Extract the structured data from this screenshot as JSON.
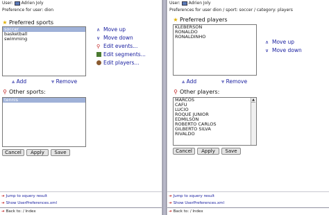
{
  "left": {
    "header": {
      "user_label": "User:",
      "user_name": "Adrien Joly"
    },
    "subtitle": "Preference for user: dion",
    "preferred": {
      "title": "Preferred sports",
      "items": [
        "soccer",
        "basketball",
        "swimming"
      ],
      "selected_index": 0
    },
    "actions": [
      {
        "icon": "up-arrow-icon",
        "label": "Move up"
      },
      {
        "icon": "down-arrow-icon",
        "label": "Move down"
      },
      {
        "icon": "pin-icon",
        "label": "Edit events..."
      },
      {
        "icon": "segments-icon",
        "label": "Edit segments..."
      },
      {
        "icon": "player-icon",
        "label": "Edit players..."
      }
    ],
    "add_label": "Add",
    "remove_label": "Remove",
    "other": {
      "title": "Other sports:",
      "items": [
        "tennis"
      ],
      "selected_index": 0
    },
    "buttons": {
      "cancel": "Cancel",
      "apply": "Apply",
      "save": "Save"
    },
    "links": [
      "Jump to xquery result",
      "Show UserPreferences.xml"
    ],
    "back": "Back to: / Index"
  },
  "right": {
    "subtitle": "Preferences for user dion / sport: soccer / category: players",
    "preferred": {
      "title": "Preferred players",
      "items": [
        "KLEBERSON",
        "RONALDO",
        "RONALDINHO"
      ]
    },
    "actions": [
      {
        "icon": "up-arrow-icon",
        "label": "Move up"
      },
      {
        "icon": "down-arrow-icon",
        "label": "Move down"
      }
    ],
    "add_label": "Add",
    "remove_label": "Remove",
    "other": {
      "title": "Other players:",
      "items": [
        "MARCOS",
        "CAFU",
        "LUCIO",
        "ROQUE JUNIOR",
        "EDMILSON",
        "ROBERTO CARLOS",
        "GILBERTO SILVA",
        "RIVALDO"
      ]
    },
    "buttons": {
      "cancel": "Cancel",
      "apply": "Apply",
      "save": "Save"
    },
    "links": [
      "Jump to xquery result",
      "Show UserPreferences.xml"
    ],
    "back": "Back to: / Index"
  },
  "colors": {
    "link": "#1a20a0",
    "selection": "#9fb1d8",
    "star": "#e0b000"
  }
}
